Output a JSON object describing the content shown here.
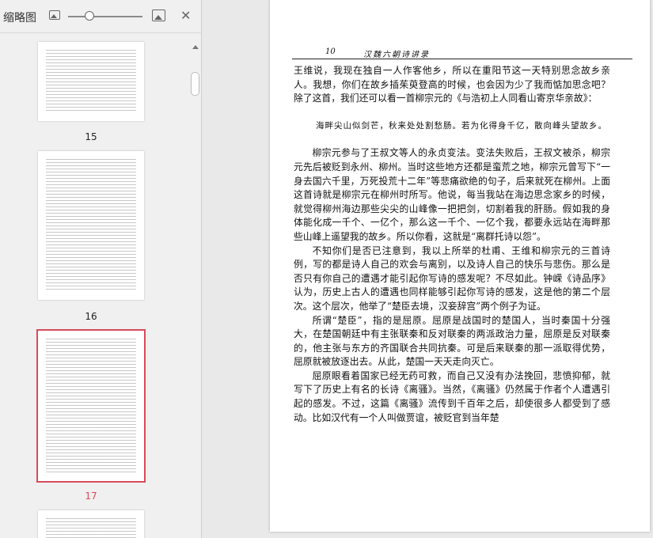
{
  "sidebar": {
    "title": "缩略图",
    "icons": [
      "small-image-icon",
      "zoom-slider",
      "large-image-icon",
      "close-icon"
    ],
    "zoom_value_fraction": 0.3,
    "thumbnails": [
      {
        "label": "15",
        "selected": false
      },
      {
        "label": "16",
        "selected": false
      },
      {
        "label": "17",
        "selected": true
      },
      {
        "label": "",
        "selected": false
      }
    ]
  },
  "page": {
    "running_head": {
      "page_number": "10",
      "book_title": "汉魏六朝诗讲录"
    },
    "paragraphs": [
      {
        "style": "cont",
        "text": "王维说，我现在独自一人作客他乡，所以在重阳节这一天特别思念故乡亲人。我想，你们在故乡插茱萸登高的时候，也会因为少了我而惦加思念吧？除了这首，我们还可以看一首柳宗元的《与浩初上人同看山寄京华亲故》："
      },
      {
        "style": "quote",
        "text": "海畔尖山似剑芒，秋来处处割愁肠。若为化得身千亿，散向峰头望故乡。"
      },
      {
        "style": "ind",
        "text": "柳宗元参与了王叔文等人的永贞变法。变法失败后，王叔文被杀，柳宗元先后被贬到永州、柳州。当时这些地方还都是蛮荒之地，柳宗元曾写下“一身去国六千里，万死投荒十二年”等悲痛欲绝的句子，后来就死在柳州。上面这首诗就是柳宗元在柳州时所写。他说，每当我站在海边思念家乡的时候，就觉得柳州海边那些尖尖的山峰像一把把剑，切割着我的肝肠。假如我的身体能化成一千个、一亿个，那么这一千个、一亿个我，都要永远站在海畔那些山峰上遥望我的故乡。所以你看，这就是“离群托诗以怨”。"
      },
      {
        "style": "ind",
        "text": "不知你们是否已注意到，我以上所举的杜甫、王维和柳宗元的三首诗例，写的都是诗人自己的欢会与离别，以及诗人自己的快乐与悲伤。那么是否只有你自己的遭遇才能引起你写诗的感发呢？不尽如此。钟嵘《诗品序》认为，历史上古人的遭遇也同样能够引起你写诗的感发，这是他的第二个层次。这个层次，他举了“楚臣去境，汉妾辞宫”两个例子为证。"
      },
      {
        "style": "ind",
        "text": "所谓“楚臣”，指的是屈原。屈原是战国时的楚国人，当时秦国十分强大，在楚国朝廷中有主张联秦和反对联秦的两派政治力量，屈原是反对联秦的，他主张与东方的齐国联合共同抗秦。可是后来联秦的那一派取得优势，屈原就被放逐出去。从此，楚国一天天走向灭亡。"
      },
      {
        "style": "ind",
        "text": "屈原眼看着国家已经无药可救，而自己又没有办法挽回，悲愤抑郁，就写下了历史上有名的长诗《离骚》。当然，《离骚》仍然属于作者个人遭遇引起的感发。不过，这篇《离骚》流传到千百年之后，却使很多人都受到了感动。比如汉代有一个人叫做贾谊，被贬官到当年楚"
      }
    ]
  }
}
